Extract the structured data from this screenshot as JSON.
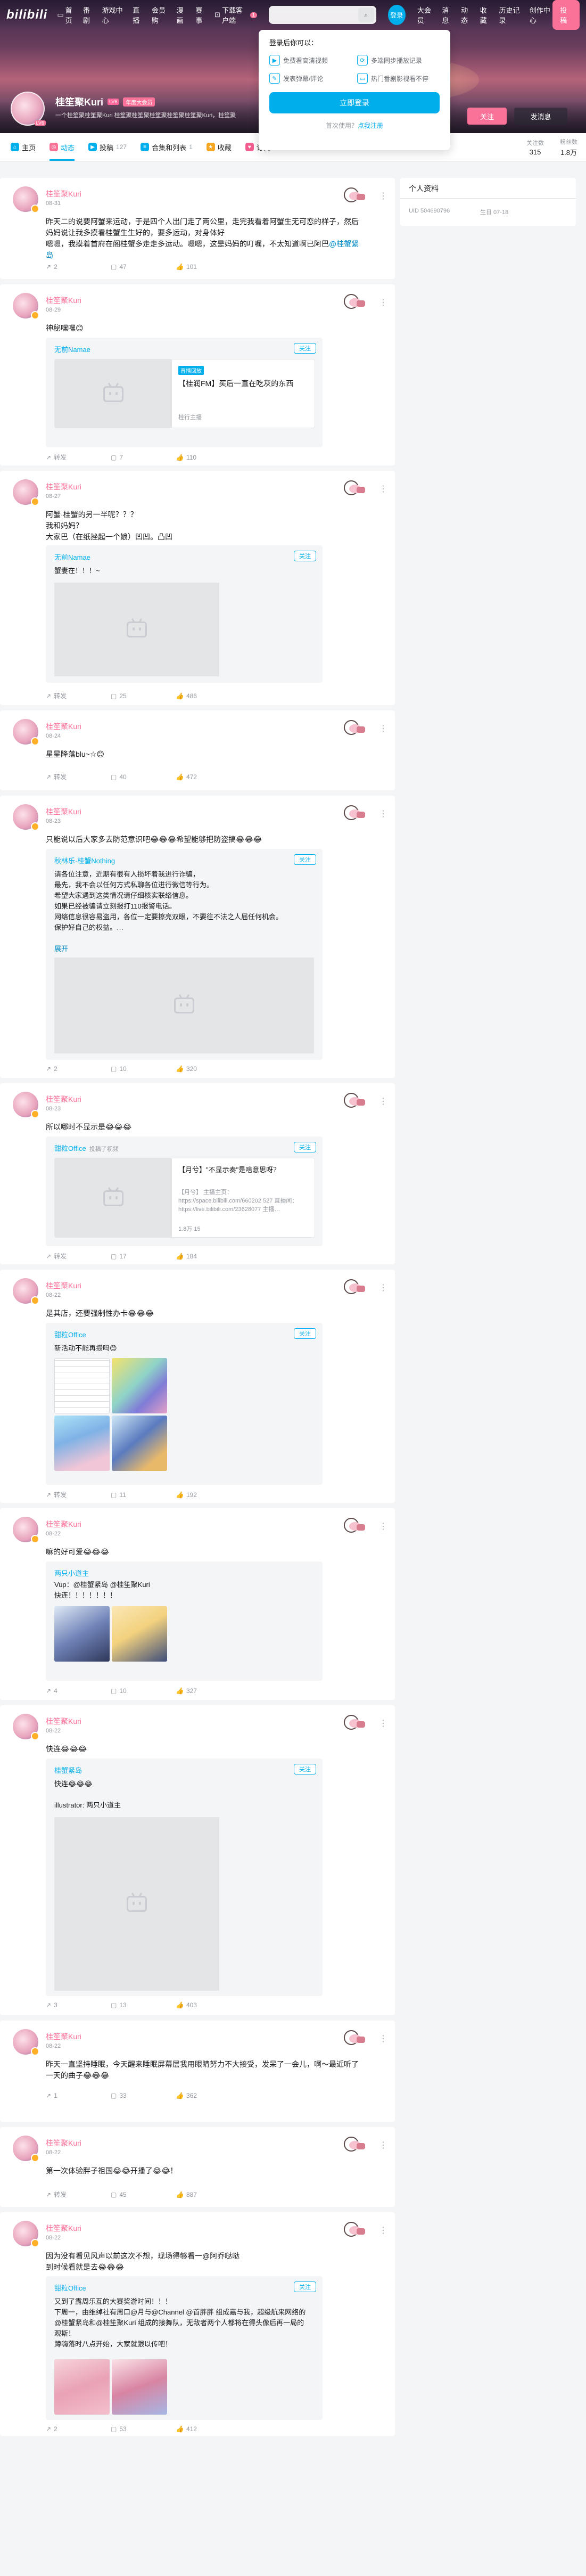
{
  "topbar": {
    "logo": "bilibili",
    "nav_left": [
      "首页",
      "番剧",
      "游戏中心",
      "直播",
      "会员购",
      "漫画",
      "赛事",
      "下载客户端"
    ],
    "download_badge": "1",
    "login_avatar_label": "登录",
    "nav_right": [
      "大会员",
      "消息",
      "动态",
      "收藏",
      "历史记录",
      "创作中心"
    ],
    "upload": "投稿"
  },
  "login_popup": {
    "title": "登录后你可以：",
    "benefits": [
      "免费看高清视频",
      "多端同步播放记录",
      "发表弹幕/评论",
      "热门番剧影视看不停"
    ],
    "login_button": "立即登录",
    "register_prompt": "首次使用？",
    "register_link": "点我注册"
  },
  "profile": {
    "name": "桂笙聚Kuri",
    "level": "LV6",
    "vip": "年度大会员",
    "sign": "一个桂笙聚桂笙聚Kuri 桂笙聚桂笙聚桂笙聚桂笙聚桂笙聚Kuri，桂笙聚",
    "follow_button": "关注",
    "message_button": "发消息"
  },
  "tabs": [
    {
      "label": "主页",
      "count": "",
      "color": "#00aeec"
    },
    {
      "label": "动态",
      "count": "",
      "color": "#fb7299"
    },
    {
      "label": "投稿",
      "count": "127",
      "color": "#00aeec"
    },
    {
      "label": "合集和列表",
      "count": "1",
      "color": "#00aeec"
    },
    {
      "label": "收藏",
      "count": "",
      "color": "#f5a623"
    },
    {
      "label": "订阅",
      "count": "",
      "color": "#f25d8e"
    }
  ],
  "stats": [
    {
      "label": "关注数",
      "value": "315"
    },
    {
      "label": "粉丝数",
      "value": "1.8万"
    }
  ],
  "sidebar": {
    "title": "个人资料",
    "uid": "UID 504690796",
    "birthday": "生日 07-18"
  },
  "posts": [
    {
      "author": "桂笙聚Kuri",
      "date": "08-31",
      "text": "昨天二的说要阿蟹来运动，于是四个人出门走了两公里，走完我看着阿蟹生无可恋的样子，然后妈妈说让我多摸看桂蟹生生好的，要多运动，对身体好\n嗯嗯，我摸着首府在阁桂蟹多走走多运动。嗯嗯，这是妈妈的叮嘱，不太知道啊已阿巴",
      "tag": "@桂蟹紧岛",
      "actions": [
        "2",
        "47",
        "101"
      ]
    },
    {
      "author": "桂笙聚Kuri",
      "date": "08-29",
      "text": "神秘嘿嘿😊",
      "card": {
        "author": "无前Namae",
        "follow": "关注",
        "video_tag": "直播回放",
        "title": "【桂润FM】买后一直在吃灰的东西",
        "meta": "桂行主播"
      },
      "actions": [
        "转发",
        "7",
        "110"
      ]
    },
    {
      "author": "桂笙聚Kuri",
      "date": "08-27",
      "text": "阿蟹·桂蟹的另一半呢？？？\n我和妈妈？\n大家巴（在纸挫起一个娘）凹凹。凸凹",
      "card": {
        "author": "无前Namae",
        "follow": "关注",
        "text": "蟹妻在！！！~"
      },
      "actions": [
        "转发",
        "25",
        "486"
      ]
    },
    {
      "author": "桂笙聚Kuri",
      "date": "08-24",
      "text": "星星降落blu~☆😊",
      "actions": [
        "转发",
        "40",
        "472"
      ]
    },
    {
      "author": "桂笙聚Kuri",
      "date": "08-23",
      "text": "只能说以后大家多去防范意识吧😂😂😂希望能够把防盗搞😂😂😂",
      "card": {
        "author": "秋林乐·桂蟹Nothing",
        "follow": "关注",
        "text": "请各位注意，近期有很有人损坏着我进行诈骗，\n最先，我不会以任何方式私聊各位进行微信等行为。\n希望大家遇到这类情况请仔细核实联络信息。\n如果已经被骗请立刻报打110报警电话。\n网络信息很容易盗用，各位一定要擦亮双眼，不要往不法之人届任何机会。\n保护好自己的权益。…",
        "expand": "展开"
      },
      "actions": [
        "2",
        "10",
        "320"
      ]
    },
    {
      "author": "桂笙聚Kuri",
      "date": "08-23",
      "text": "所以哪时不显示是😂😂😂",
      "card": {
        "author": "甜粒Office",
        "sub": "投稿了视频",
        "follow": "关注",
        "title": "【月兮】\"不显示奏\"是啥意思呀？",
        "desc": "【月兮】 主播主页：https://space.bilibili.com/660202 527 直播间：https://live.bilibili.com/23628077 主播…",
        "meta": "1.8万  15"
      },
      "actions": [
        "转发",
        "17",
        "184"
      ]
    },
    {
      "author": "桂笙聚Kuri",
      "date": "08-22",
      "text": "是其店，还要强制性办卡😂😂😂",
      "card": {
        "author": "甜粒Office",
        "follow": "关注",
        "text": "新活动不能再攒吗😊"
      },
      "actions": [
        "转发",
        "11",
        "192"
      ]
    },
    {
      "author": "桂笙聚Kuri",
      "date": "08-22",
      "text": "嘛的好可爱😂😂😂",
      "card": {
        "author": "两只小道主",
        "follow": "关注",
        "text": "Vup：@桂蟹紧岛 @桂笙聚Kuri\n快连！！！！！！！"
      },
      "actions": [
        "4",
        "10",
        "327"
      ]
    },
    {
      "author": "桂笙聚Kuri",
      "date": "08-22",
      "text": "快连😂😂😂",
      "card": {
        "author": "桂蟹紧岛",
        "follow": "关注",
        "text": "快连😂😂😂\n\nillustrator: 两只小道主"
      },
      "actions": [
        "3",
        "13",
        "403"
      ]
    },
    {
      "author": "桂笙聚Kuri",
      "date": "08-22",
      "text": "昨天一直坚持睡眠，今天醒来睡眠屏幕层我用眼睛努力不大接受，发呆了一会儿，啊～最近听了一天的曲子😂😂😂",
      "actions": [
        "1",
        "33",
        "362"
      ]
    },
    {
      "author": "桂笙聚Kuri",
      "date": "08-22",
      "text": "第一次体验胖子祖国😂😂开播了😂😂！",
      "actions": [
        "转发",
        "45",
        "887"
      ]
    },
    {
      "author": "桂笙聚Kuri",
      "date": "08-22",
      "text": "因为没有看见风声以前这次不想，现场得够看一@阿乔哒哒\n到时候看就是去😂😂😂",
      "card": {
        "author": "甜粒Office",
        "follow": "关注",
        "text": "又到了露周乐互的大赛奖游时间！！！\n下周一，由维绰社有周口@月与@Channel @首胖胖 组成嘉与我，超级航来网络的@桂蟹紧岛和@桂笙聚Kuri 组成的接舞队，无敌者两个人都将在得头像后再一局的观斯！\n蹲嗨落时八点开始，大家就跟以传吧！"
      },
      "actions": [
        "2",
        "53",
        "412"
      ]
    }
  ]
}
